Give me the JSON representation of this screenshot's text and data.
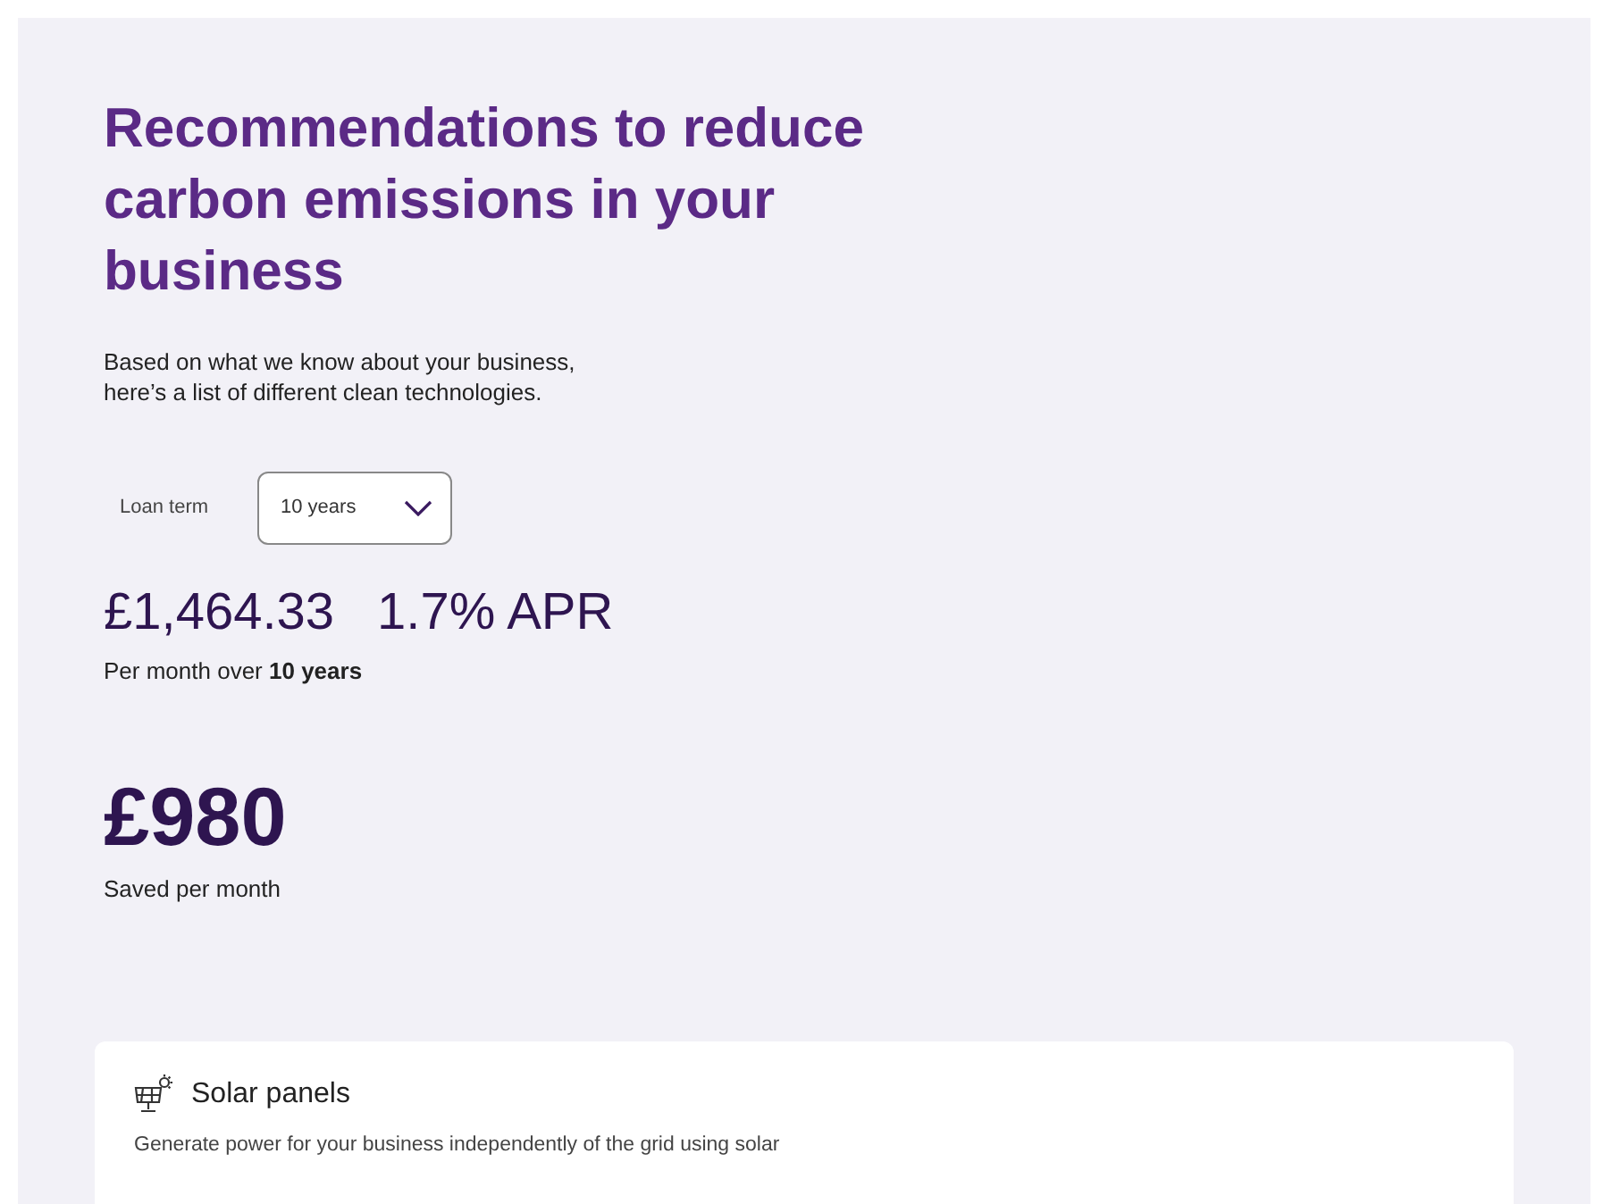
{
  "heading": "Recommendations to reduce carbon emissions in your business",
  "intro": "Based on what we know about your business, here’s a list of different clean technologies.",
  "loan_term": {
    "label": "Loan term",
    "value": "10 years"
  },
  "monthly_payment": "£1,464.33",
  "apr": "1.7% APR",
  "payment_note": "Per month over **10 years**",
  "saving": {
    "amount": "£980",
    "label": "Saved per month"
  },
  "technologies": [
    {
      "title": "Solar panels",
      "description": "Generate power for your business independently of the grid using solar"
    }
  ]
}
